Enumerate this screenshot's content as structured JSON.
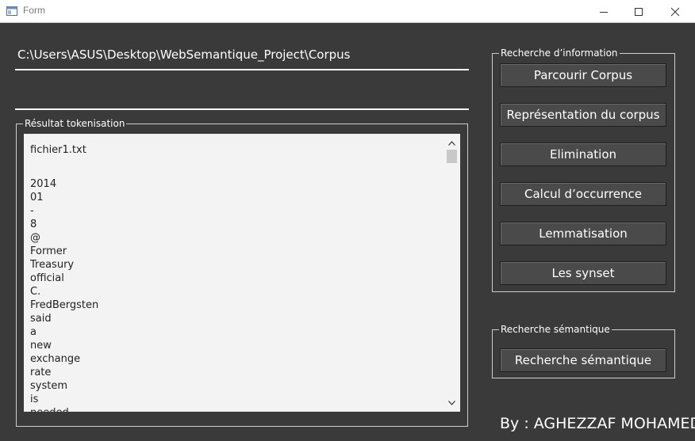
{
  "window": {
    "title": "Form"
  },
  "path_display": {
    "value": "C:\\Users\\ASUS\\Desktop\\WebSemantique_Project\\Corpus"
  },
  "tokenisation_group": {
    "title": "Résultat tokenisation",
    "header_line": "fichier1.txt",
    "tokens": [
      "2014",
      "01",
      "-",
      "8",
      "@",
      "Former",
      "Treasury",
      "official",
      "C.",
      "FredBergsten",
      "said",
      "a",
      "new",
      "exchange",
      "rate",
      "system",
      "is",
      "needed"
    ]
  },
  "info_group": {
    "title": "Recherche d’information",
    "buttons": {
      "parcourir": "Parcourir Corpus",
      "representation": "Représentation du corpus",
      "elimination": "Elimination",
      "occurrence": "Calcul d’occurrence",
      "lemmatisation": "Lemmatisation",
      "synset": "Les synset"
    }
  },
  "semantic_group": {
    "title": "Recherche sémantique",
    "button": "Recherche sémantique"
  },
  "footer": {
    "byline": "By : AGHEZZAF MOHAMED"
  },
  "icons": {
    "app": "form-window-icon",
    "minimize": "minimize-icon",
    "maximize": "maximize-icon",
    "close": "close-icon",
    "scroll_up": "chevron-up-icon",
    "scroll_down": "chevron-down-icon"
  },
  "colors": {
    "background": "#3a3a3a",
    "button": "#4a4a4a",
    "text_area": "#f3f3f3",
    "text": "#ffffff"
  }
}
